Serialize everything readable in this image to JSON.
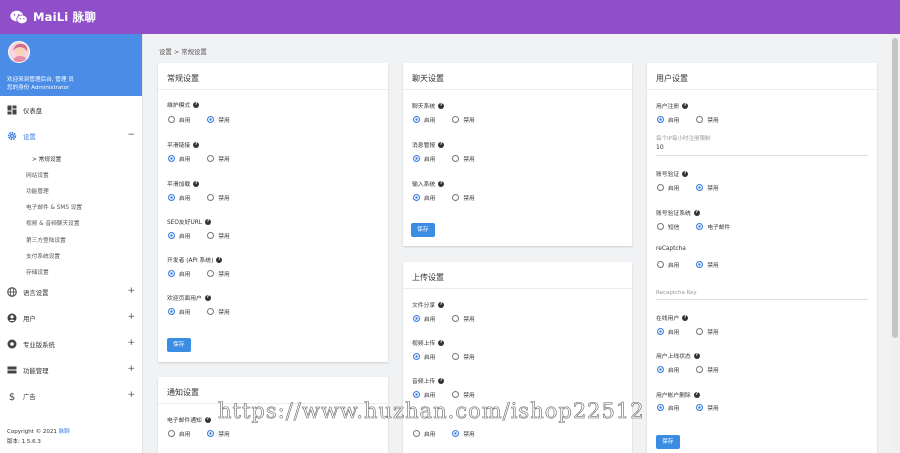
{
  "topbar": {
    "brand": "MaiLi 脉聊",
    "icon": "wechat-icon",
    "color": "#8e4fc9"
  },
  "sidebar": {
    "welcome": "欢迎来到管理后台, 管理 员",
    "role": "您的身份 Administrator",
    "items": [
      {
        "label": "仪表盘",
        "icon": "dashboard-icon",
        "sign": ""
      },
      {
        "label": "设置",
        "icon": "gear-icon",
        "sign": "−"
      },
      {
        "label": "语言设置",
        "icon": "globe-icon",
        "sign": "+"
      },
      {
        "label": "用户",
        "icon": "user-icon",
        "sign": "+"
      },
      {
        "label": "专业版系统",
        "icon": "settings-circle-icon",
        "sign": "+"
      },
      {
        "label": "功能管理",
        "icon": "server-icon",
        "sign": "+"
      },
      {
        "label": "广告",
        "icon": "dollar-icon",
        "sign": "+"
      }
    ],
    "sub_items": [
      "> 常规设置",
      "网站设置",
      "功能管理",
      "电子邮件 & SMS 设置",
      "视频 & 音频聊天设置",
      "第三方登陆设置",
      "支付系统设置",
      "存储设置"
    ],
    "copyright": "Copyright © 2021",
    "copyright_brand": "脉聊",
    "version": "版本: 1.5.6.3"
  },
  "breadcrumb": "设置 > 常规设置",
  "cards": {
    "general": {
      "title": "常规设置",
      "save": "保存",
      "fields": [
        {
          "label": "维护模式",
          "options": [
            "启用",
            "禁用"
          ],
          "selected": 1
        },
        {
          "label": "平滑链接",
          "options": [
            "启用",
            "禁用"
          ],
          "selected": 0
        },
        {
          "label": "平滑加载",
          "options": [
            "启用",
            "禁用"
          ],
          "selected": 0
        },
        {
          "label": "SEO友好URL",
          "options": [
            "启用",
            "禁用"
          ],
          "selected": 0
        },
        {
          "label": "开发者 (API 系统)",
          "options": [
            "启用",
            "禁用"
          ],
          "selected": 0
        },
        {
          "label": "欢迎页面用户",
          "options": [
            "启用",
            "禁用"
          ],
          "selected": 0
        }
      ]
    },
    "notify": {
      "title": "通知设置",
      "fields": [
        {
          "label": "电子邮件通知",
          "options": [
            "启用",
            "禁用"
          ],
          "selected": 1
        }
      ]
    },
    "chat": {
      "title": "聊天设置",
      "save": "保存",
      "fields": [
        {
          "label": "聊天系统",
          "options": [
            "启用",
            "禁用"
          ],
          "selected": 0
        },
        {
          "label": "消息管报",
          "options": [
            "启用",
            "禁用"
          ],
          "selected": 0
        },
        {
          "label": "输入系统",
          "options": [
            "启用",
            "禁用"
          ],
          "selected": 0
        }
      ]
    },
    "upload": {
      "title": "上传设置",
      "fields": [
        {
          "label": "文件分享",
          "options": [
            "启用",
            "禁用"
          ],
          "selected": 0
        },
        {
          "label": "视频上传",
          "options": [
            "启用",
            "禁用"
          ],
          "selected": 0
        },
        {
          "label": "音频上传",
          "options": [
            "启用",
            "禁用"
          ],
          "selected": 0
        },
        {
          "label": "",
          "options": [
            "启用",
            "禁用"
          ],
          "selected": 1
        }
      ]
    },
    "user": {
      "title": "用户设置",
      "save": "保存",
      "reg_label": "用户注册",
      "reg_options": [
        "启用",
        "禁用"
      ],
      "reg_selected": 0,
      "limit_label": "每个IP每小时注册限制",
      "limit_value": "10",
      "fields": [
        {
          "label": "账号验证",
          "options": [
            "启用",
            "禁用"
          ],
          "selected": 1
        },
        {
          "label": "账号验证系统",
          "options": [
            "短信",
            "电子邮件"
          ],
          "selected": 1
        },
        {
          "label": "reCaptcha",
          "options": [
            "启用",
            "禁用"
          ],
          "selected": 1
        }
      ],
      "recaptcha_key_label": "Recaptcha Key",
      "fields2": [
        {
          "label": "在线用户",
          "options": [
            "启用",
            "禁用"
          ],
          "selected": 0
        },
        {
          "label": "用户上线状态",
          "options": [
            "启用",
            "禁用"
          ],
          "selected": 0
        },
        {
          "label": "用户帐户删除",
          "options": [
            "启用",
            "禁用"
          ],
          "selected": 0
        }
      ]
    }
  },
  "watermark": "https://www.huzhan.com/ishop22512"
}
